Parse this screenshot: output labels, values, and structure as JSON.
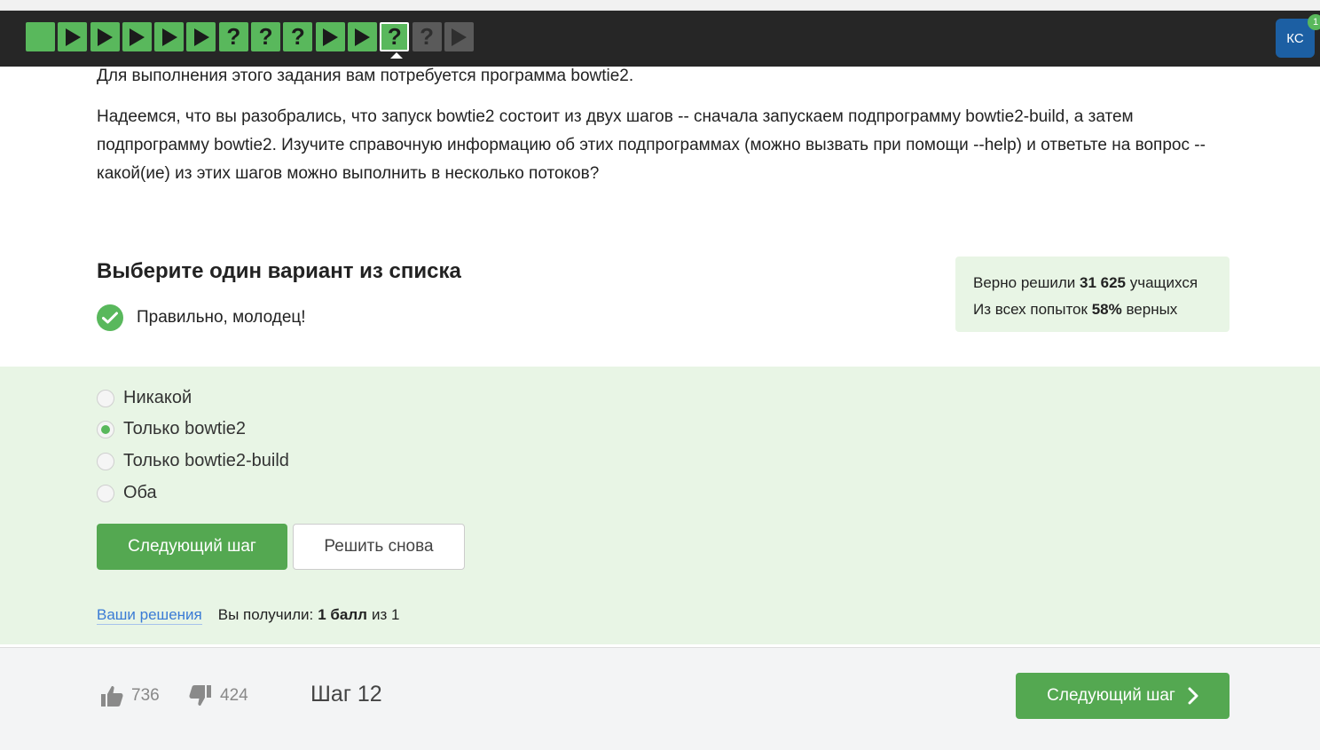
{
  "step_nav": {
    "steps": [
      {
        "type": "text",
        "state": "done"
      },
      {
        "type": "video",
        "state": "done"
      },
      {
        "type": "video",
        "state": "done"
      },
      {
        "type": "video",
        "state": "done"
      },
      {
        "type": "video",
        "state": "done"
      },
      {
        "type": "video",
        "state": "done"
      },
      {
        "type": "quiz",
        "state": "done"
      },
      {
        "type": "quiz",
        "state": "done"
      },
      {
        "type": "quiz",
        "state": "done"
      },
      {
        "type": "video",
        "state": "done"
      },
      {
        "type": "video",
        "state": "done"
      },
      {
        "type": "quiz",
        "state": "current"
      },
      {
        "type": "quiz",
        "state": "locked"
      },
      {
        "type": "video",
        "state": "locked"
      }
    ],
    "quiz_glyph": "?",
    "colors": {
      "done": "#59b85c",
      "locked": "#5a5a5a",
      "bar": "#262626"
    }
  },
  "user": {
    "initials": "КС",
    "notifications": "1"
  },
  "task": {
    "cut_line": "Для выполнения этого задания вам потребуется программа bowtie2.",
    "question": "Надеемся, что вы разобрались, что запуск bowtie2 состоит из двух шагов -- сначала запускаем подпрограмму bowtie2-build, а затем подпрограмму bowtie2. Изучите справочную информацию об этих подпрограммах (можно вызвать при помощи --help) и ответьте на вопрос -- какой(ие) из этих шагов можно выполнить в несколько потоков?"
  },
  "quiz": {
    "title": "Выберите один вариант из списка",
    "feedback": "Правильно, молодец!",
    "options": [
      {
        "label": "Никакой",
        "checked": false
      },
      {
        "label": "Только bowtie2",
        "checked": true
      },
      {
        "label": "Только bowtie2-build",
        "checked": false
      },
      {
        "label": "Оба",
        "checked": false
      }
    ],
    "next_label": "Следующий шаг",
    "retry_label": "Решить снова"
  },
  "stats": {
    "solved_prefix": "Верно решили",
    "solved_count": "31 625",
    "solved_suffix": "учащихся",
    "attempts_prefix": "Из всех попыток",
    "attempts_percent": "58%",
    "attempts_suffix": "верных"
  },
  "result": {
    "solutions_link": "Ваши решения",
    "got_label": "Вы получили:",
    "got_value": "1 балл",
    "got_of": "из 1"
  },
  "footer": {
    "likes": "736",
    "dislikes": "424",
    "step_label": "Шаг 12",
    "next_label": "Следующий шаг"
  },
  "colors": {
    "accent": "#54a851",
    "panel": "#e8f5e5",
    "link": "#3a7bd5"
  }
}
